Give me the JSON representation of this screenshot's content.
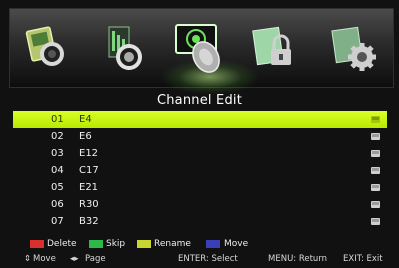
{
  "screen_title": "Channel Edit",
  "menu_icons": [
    {
      "name": "picture-icon",
      "selected": false
    },
    {
      "name": "audio-icon",
      "selected": false
    },
    {
      "name": "channel-icon",
      "selected": true
    },
    {
      "name": "lock-icon",
      "selected": false
    },
    {
      "name": "setup-icon",
      "selected": false
    }
  ],
  "channels": [
    {
      "num": "01",
      "name": "E4",
      "selected": true
    },
    {
      "num": "02",
      "name": "E6",
      "selected": false
    },
    {
      "num": "03",
      "name": "E12",
      "selected": false
    },
    {
      "num": "04",
      "name": "C17",
      "selected": false
    },
    {
      "num": "05",
      "name": "E21",
      "selected": false
    },
    {
      "num": "06",
      "name": "R30",
      "selected": false
    },
    {
      "num": "07",
      "name": "B32",
      "selected": false
    }
  ],
  "legend": {
    "delete": {
      "label": "Delete",
      "color": "#d9302e"
    },
    "skip": {
      "label": "Skip",
      "color": "#2fb84a"
    },
    "rename": {
      "label": "Rename",
      "color": "#c9d530"
    },
    "move": {
      "label": "Move",
      "color": "#3a3fb8"
    }
  },
  "hints": {
    "move": "Move",
    "page": "Page",
    "enter": "ENTER: Select",
    "menu": "MENU: Return",
    "exit": "EXIT: Exit"
  }
}
